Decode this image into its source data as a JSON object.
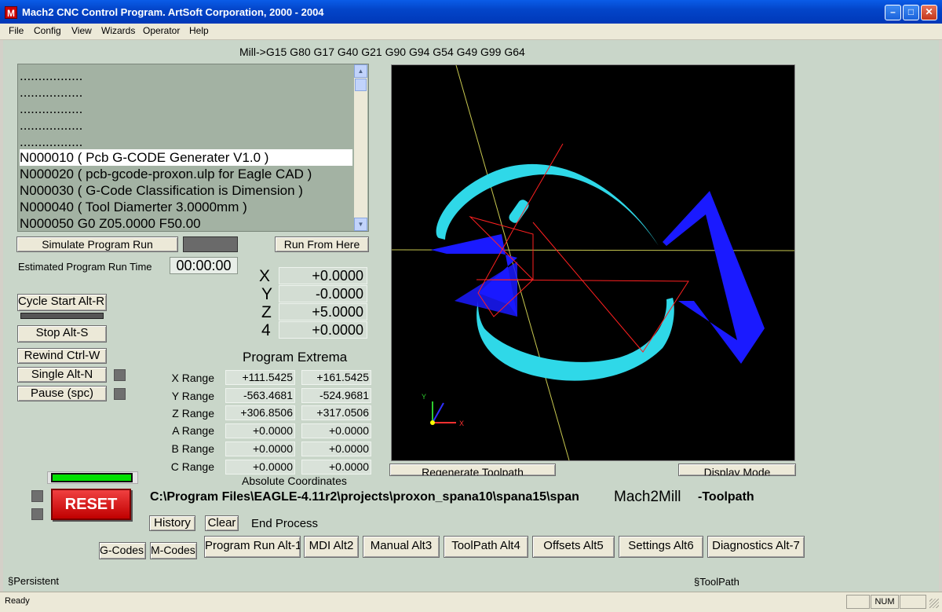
{
  "window": {
    "title": "Mach2 CNC Control Program. ArtSoft Corporation, 2000 - 2004",
    "icon_letter": "M",
    "minimize": "–",
    "maximize": "□",
    "close": "✕"
  },
  "menu": [
    "File",
    "Config",
    "View",
    "Wizards",
    "Operator",
    "Help"
  ],
  "mode_line": "Mill->G15  G80 G17 G40 G21 G90 G94 G54 G49 G99 G64",
  "gcode_lines": [
    ".................",
    ".................",
    ".................",
    ".................",
    ".................",
    "N000010  ( Pcb G-CODE Generater V1.0 )",
    "N000020  ( pcb-gcode-proxon.ulp for Eagle CAD )",
    "N000030  ( G-Code Classification is Dimension )",
    "N000040  ( Tool Diamerter  3.0000mm )",
    "N000050  G0 Z05.0000 F50.00"
  ],
  "buttons": {
    "simulate": "Simulate Program Run",
    "run_from_here": "Run From Here",
    "cycle_start": "Cycle Start Alt-R",
    "stop": "Stop Alt-S",
    "rewind": "Rewind Ctrl-W",
    "single": "Single Alt-N",
    "pause": "Pause (spc)",
    "reset": "RESET",
    "history": "History",
    "clear": "Clear",
    "regenerate": "Regenerate Toolpath",
    "display_mode": "Display Mode",
    "gcodes": "G-Codes",
    "mcodes": "M-Codes"
  },
  "run_time": {
    "label": "Estimated Program Run Time",
    "value": "00:00:00"
  },
  "dro": [
    {
      "axis": "X",
      "value": "+0.0000"
    },
    {
      "axis": "Y",
      "value": "-0.0000"
    },
    {
      "axis": "Z",
      "value": "+5.0000"
    },
    {
      "axis": "4",
      "value": "+0.0000"
    }
  ],
  "extrema": {
    "title": "Program Extrema",
    "rows": [
      {
        "label": "X Range",
        "min": "+111.5425",
        "max": "+161.5425"
      },
      {
        "label": "Y Range",
        "min": "-563.4681",
        "max": "-524.9681"
      },
      {
        "label": "Z Range",
        "min": "+306.8506",
        "max": "+317.0506"
      },
      {
        "label": "A Range",
        "min": "+0.0000",
        "max": "+0.0000"
      },
      {
        "label": "B Range",
        "min": "+0.0000",
        "max": "+0.0000"
      },
      {
        "label": "C Range",
        "min": "+0.0000",
        "max": "+0.0000"
      }
    ],
    "footer": "Absolute Coordinates"
  },
  "file_path": "C:\\Program Files\\EAGLE-4.11r2\\projects\\proxon_spana10\\spana15\\span",
  "profile": "Mach2Mill",
  "screen_name": "-Toolpath",
  "end_process": "End Process",
  "tabs": [
    "Program Run Alt-1",
    "MDI Alt2",
    "Manual Alt3",
    "ToolPath Alt4",
    "Offsets Alt5",
    "Settings Alt6",
    "Diagnostics Alt-7"
  ],
  "persistent": "§Persistent",
  "toolpath_label": "§ToolPath",
  "axes": {
    "x": "X",
    "y": "Y"
  },
  "status": {
    "ready": "Ready",
    "num": "NUM"
  },
  "colors": {
    "toolpath_cyan": "#33e0ee",
    "toolpath_blue": "#1a1aff",
    "reset_red": "#e01010"
  }
}
